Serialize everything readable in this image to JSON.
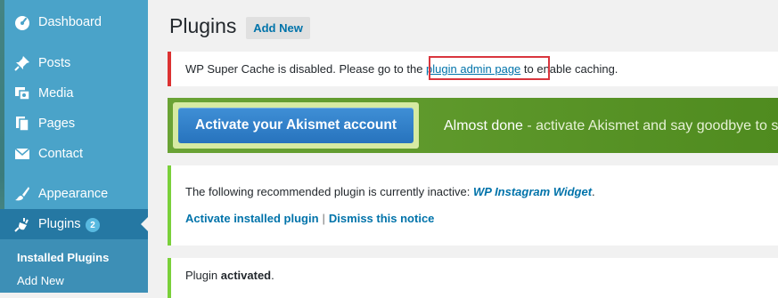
{
  "sidebar": {
    "items": [
      {
        "label": "Dashboard",
        "icon": "dashboard-icon"
      },
      {
        "label": "Posts",
        "icon": "pin-icon"
      },
      {
        "label": "Media",
        "icon": "media-icon"
      },
      {
        "label": "Pages",
        "icon": "pages-icon"
      },
      {
        "label": "Contact",
        "icon": "envelope-icon"
      },
      {
        "label": "Appearance",
        "icon": "paintbrush-icon"
      },
      {
        "label": "Plugins",
        "icon": "plug-icon",
        "count": "2"
      }
    ],
    "submenu": [
      {
        "label": "Installed Plugins"
      },
      {
        "label": "Add New"
      }
    ]
  },
  "header": {
    "title": "Plugins",
    "add_new": "Add New"
  },
  "notices": {
    "super_cache": {
      "before": "WP Super Cache is disabled. Please go to the ",
      "link": "plugin admin page",
      "after": " to enable caching."
    },
    "akismet": {
      "button": "Activate your Akismet account",
      "text_strong": "Almost done",
      "text_rest": " - activate Akismet and say goodbye to sp"
    },
    "recommended": {
      "line_before": "The following recommended plugin is currently inactive: ",
      "plugin_name": "WP Instagram Widget",
      "line_after": ".",
      "activate_link": "Activate installed plugin",
      "separator": "|",
      "dismiss_link": "Dismiss this notice"
    },
    "activated": {
      "prefix": "Plugin ",
      "strong": "activated",
      "suffix": "."
    }
  },
  "colors": {
    "sidebar": "#4aa3c9",
    "sidebar_current": "#2578a3",
    "link": "#0073aa",
    "error": "#dc3232",
    "success": "#7ad03a",
    "highlight": "#d9363e"
  }
}
